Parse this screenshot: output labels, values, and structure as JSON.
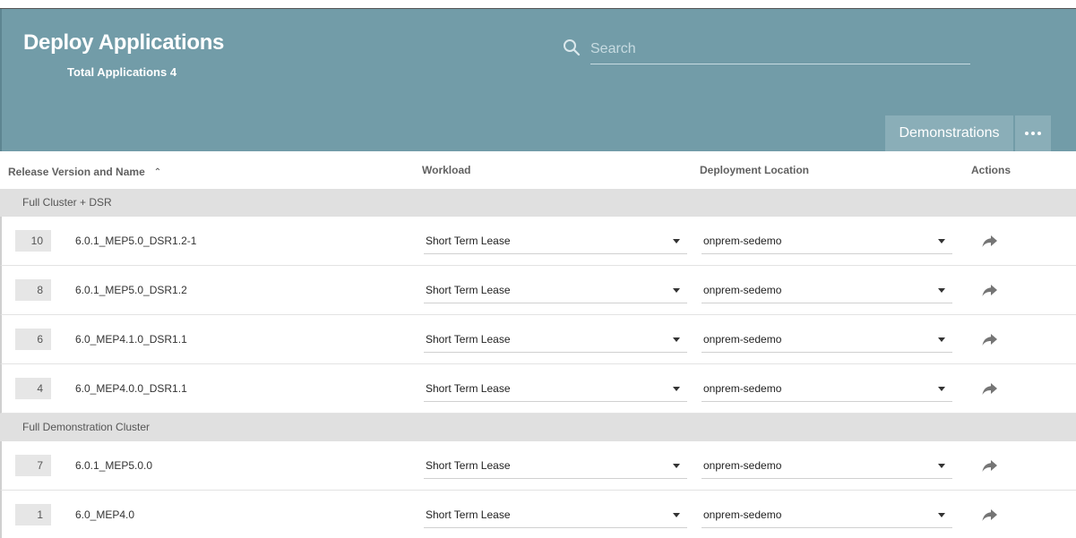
{
  "header": {
    "title": "Deploy Applications",
    "total_label": "Total Applications 4",
    "search_placeholder": "Search",
    "filter_button": "Demonstrations",
    "bg_color": "#729ca8"
  },
  "table": {
    "columns": [
      "Release Version and Name",
      "Workload",
      "Deployment Location",
      "Actions"
    ],
    "sort_icon": "chevron-up-icon",
    "groups": [
      {
        "name": "Full Cluster + DSR",
        "rows": [
          {
            "id": "10",
            "name": "6.0.1_MEP5.0_DSR1.2-1",
            "workload": "Short Term Lease",
            "location": "onprem-sedemo"
          },
          {
            "id": "8",
            "name": "6.0.1_MEP5.0_DSR1.2",
            "workload": "Short Term Lease",
            "location": "onprem-sedemo"
          },
          {
            "id": "6",
            "name": "6.0_MEP4.1.0_DSR1.1",
            "workload": "Short Term Lease",
            "location": "onprem-sedemo"
          },
          {
            "id": "4",
            "name": "6.0_MEP4.0.0_DSR1.1",
            "workload": "Short Term Lease",
            "location": "onprem-sedemo"
          }
        ]
      },
      {
        "name": "Full Demonstration Cluster",
        "rows": [
          {
            "id": "7",
            "name": "6.0.1_MEP5.0.0",
            "workload": "Short Term Lease",
            "location": "onprem-sedemo"
          },
          {
            "id": "1",
            "name": "6.0_MEP4.0",
            "workload": "Short Term Lease",
            "location": "onprem-sedemo"
          }
        ]
      }
    ]
  }
}
